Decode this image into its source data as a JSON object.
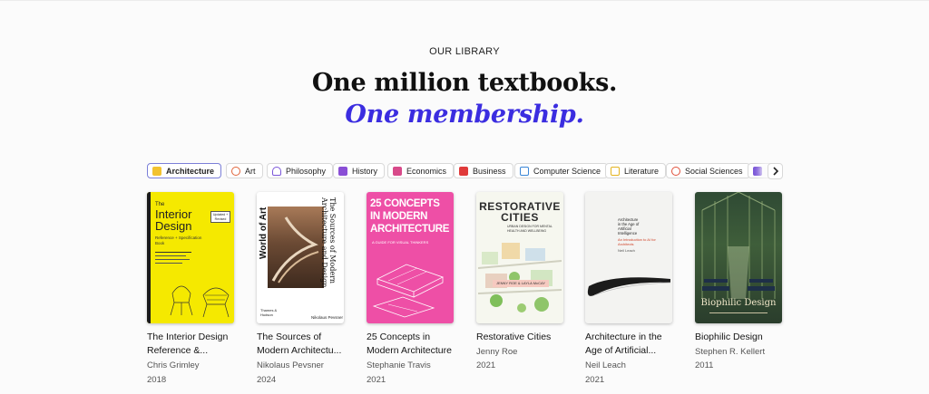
{
  "section": {
    "eyebrow": "OUR LIBRARY",
    "headline": "One million textbooks.",
    "headline_accent": "One membership."
  },
  "colors": {
    "accent": "#3b2de0",
    "background": "#fbfbfb"
  },
  "categories": [
    {
      "label": "Architecture",
      "icon": "building-icon",
      "color": "#f2c230",
      "selected": true
    },
    {
      "label": "Art",
      "icon": "palette-icon",
      "color": "#e0643a"
    },
    {
      "label": "Philosophy",
      "icon": "bust-icon",
      "color": "#7a55d8"
    },
    {
      "label": "History",
      "icon": "scroll-icon",
      "color": "#8a4fd6"
    },
    {
      "label": "Economics",
      "icon": "trend-chart-icon",
      "color": "#d84a8a"
    },
    {
      "label": "Business",
      "icon": "bar-chart-icon",
      "color": "#e03a3a"
    },
    {
      "label": "Computer Science",
      "icon": "monitor-icon",
      "color": "#3a86d6"
    },
    {
      "label": "Literature",
      "icon": "book-icon",
      "color": "#e3b320"
    },
    {
      "label": "Social Sciences",
      "icon": "people-icon",
      "color": "#e0503a"
    },
    {
      "label": "",
      "icon": "category-icon",
      "color": "#7a55d8"
    }
  ],
  "next_icon": "chevron-right-icon",
  "books": [
    {
      "title_line1": "The Interior Design",
      "title_line2": "Reference &...",
      "author": "Chris Grimley",
      "year": "2018",
      "cover": {
        "lines": [
          "The",
          "Interior",
          "Design"
        ],
        "sub": "Reference + Specification Book",
        "badge": "Updated + Revised"
      }
    },
    {
      "title_line1": "The Sources of",
      "title_line2": "Modern Architectu...",
      "author": "Nikolaus Pevsner",
      "year": "2024",
      "cover": {
        "top": "World of Art",
        "side": "The Sources of Modern Architecture and Design",
        "publisher": "Thames & Hudson",
        "author": "Nikolaus Pevsner"
      }
    },
    {
      "title_line1": "25 Concepts in",
      "title_line2": "Modern Architecture",
      "author": "Stephanie Travis",
      "year": "2021",
      "cover": {
        "lines": [
          "25 CONCEPTS",
          "IN MODERN",
          "ARCHITECTURE"
        ],
        "sub": "A GUIDE FOR VISUAL THINKERS"
      }
    },
    {
      "title_line1": "Restorative Cities",
      "title_line2": "",
      "author": "Jenny Roe",
      "year": "2021",
      "cover": {
        "lines": [
          "RESTORATIVE",
          "CITIES"
        ],
        "sub": "URBAN DESIGN FOR MENTAL HEALTH AND WELLBEING",
        "authors": "JENNY ROE & LAYLA McCAY"
      }
    },
    {
      "title_line1": "Architecture in the",
      "title_line2": "Age of Artificial...",
      "author": "Neil Leach",
      "year": "2021",
      "cover": {
        "lines": [
          "Architecture",
          "in the Age of",
          "Artificial",
          "Intelligence"
        ],
        "sub": "An Introduction to AI for Architects",
        "author": "Neil Leach"
      }
    },
    {
      "title_line1": "Biophilic Design",
      "title_line2": "",
      "author": "Stephen R. Kellert",
      "year": "2011",
      "cover": {
        "title": "Biophilic Design"
      }
    }
  ]
}
